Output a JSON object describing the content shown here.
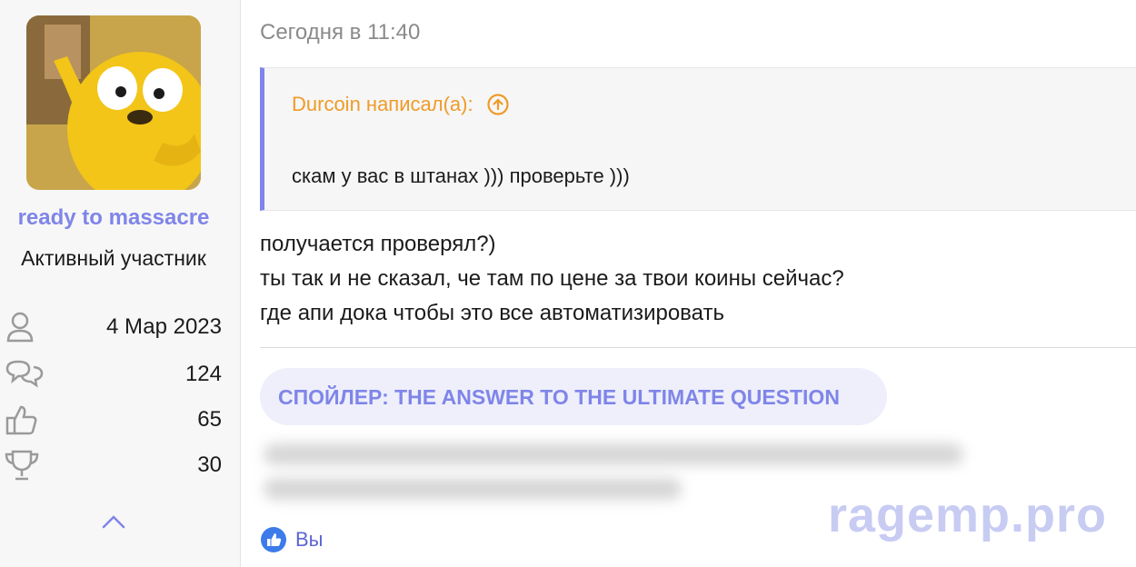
{
  "user": {
    "name": "ready to massacre",
    "title": "Активный участник",
    "stats": [
      {
        "icon": "user-icon",
        "value": "4 Мар 2023"
      },
      {
        "icon": "messages-icon",
        "value": "124"
      },
      {
        "icon": "thumbs-up-icon",
        "value": "65"
      },
      {
        "icon": "trophy-icon",
        "value": "30"
      }
    ]
  },
  "message": {
    "timestamp": "Сегодня в 11:40",
    "quote": {
      "author": "Durcoin написал(а):",
      "text": "скам у вас в штанах ))) проверьте )))"
    },
    "lines": [
      "получается проверял?)",
      "ты так и не сказал, че там по цене за твои коины сейчас?",
      "где апи дока чтобы это все автоматизировать"
    ],
    "spoiler_label": "СПОЙЛЕР: THE ANSWER TO THE ULTIMATE QUESTION",
    "reaction_label": "Вы"
  },
  "watermark": "ragemp.pro",
  "colors": {
    "accent": "#7f85e8",
    "quote_author": "#ef9b28",
    "muted": "#8a8a8a"
  }
}
